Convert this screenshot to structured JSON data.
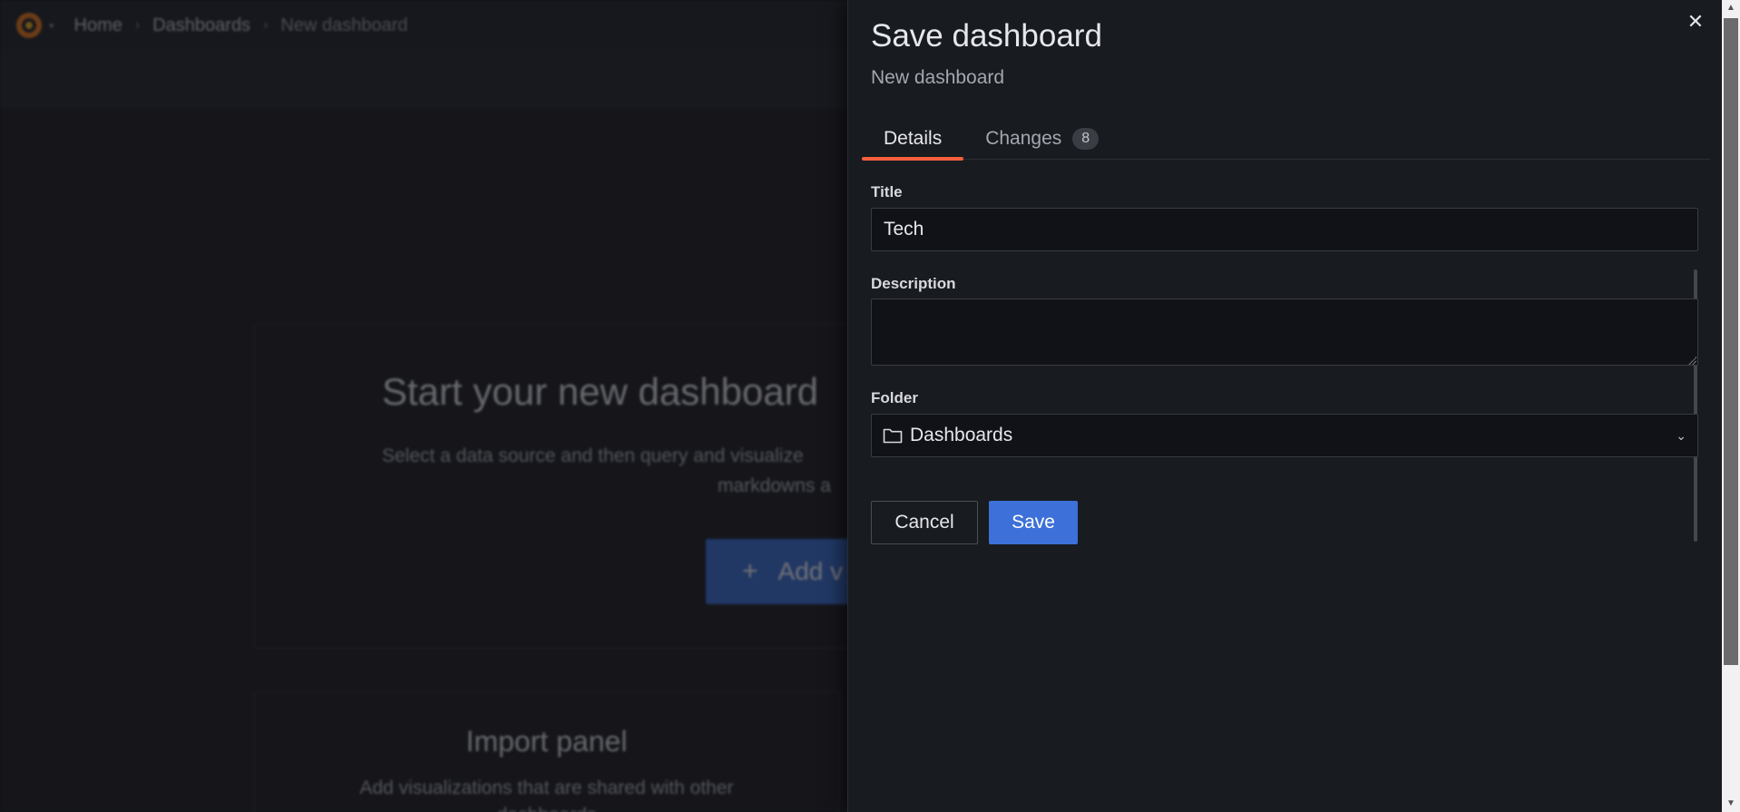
{
  "breadcrumb": {
    "items": [
      "Home",
      "Dashboards",
      "New dashboard"
    ]
  },
  "background": {
    "empty_title": "Start your new dashboard",
    "empty_desc_line1": "Select a data source and then query and visualize",
    "empty_desc_line2": "markdowns a",
    "add_button": "Add v",
    "import_title": "Import panel",
    "import_desc": "Add visualizations that are shared with other dashboards"
  },
  "drawer": {
    "title": "Save dashboard",
    "subtitle": "New dashboard",
    "tabs": [
      {
        "label": "Details",
        "active": true
      },
      {
        "label": "Changes",
        "count": "8",
        "active": false
      }
    ],
    "fields": {
      "title_label": "Title",
      "title_value": "Tech",
      "description_label": "Description",
      "description_value": "",
      "folder_label": "Folder",
      "folder_value": "Dashboards"
    },
    "buttons": {
      "cancel": "Cancel",
      "save": "Save"
    }
  },
  "colors": {
    "accent": "#3d71d9",
    "tab_underline": "#f55f3e",
    "drawer_bg": "#181b1f"
  },
  "icons": {
    "close": "close-icon",
    "folder": "folder-icon",
    "chevron": "chevron-down-icon",
    "logo": "grafana-logo"
  }
}
